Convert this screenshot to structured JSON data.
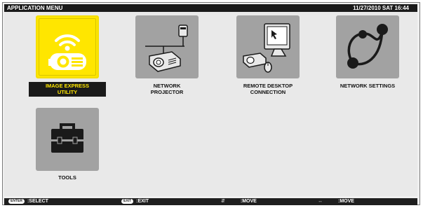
{
  "header": {
    "title": "APPLICATION MENU",
    "datetime": "11/27/2010 SAT 16:44"
  },
  "menu": {
    "items": [
      {
        "label": "IMAGE EXPRESS\nUTILITY",
        "icon": "wireless-projector-icon",
        "selected": true
      },
      {
        "label": "NETWORK\nPROJECTOR",
        "icon": "network-projector-icon",
        "selected": false
      },
      {
        "label": "REMOTE DESKTOP\nCONNECTION",
        "icon": "remote-desktop-icon",
        "selected": false
      },
      {
        "label": "NETWORK SETTINGS",
        "icon": "network-settings-icon",
        "selected": false
      },
      {
        "label": "TOOLS",
        "icon": "toolbox-icon",
        "selected": false
      }
    ]
  },
  "footer": {
    "select": {
      "key": "ENTER",
      "label": ":SELECT"
    },
    "exit": {
      "key": "EXIT",
      "label": ":EXIT"
    },
    "move_vertical": {
      "icon": "up-down-arrow-icon",
      "label": ":MOVE"
    },
    "move_horizontal": {
      "icon": "left-right-arrow-icon",
      "label": ":MOVE"
    }
  },
  "colors": {
    "selected_tile": "#ffe600",
    "tile": "#a2a2a2",
    "bar": "#1a1a1a"
  }
}
